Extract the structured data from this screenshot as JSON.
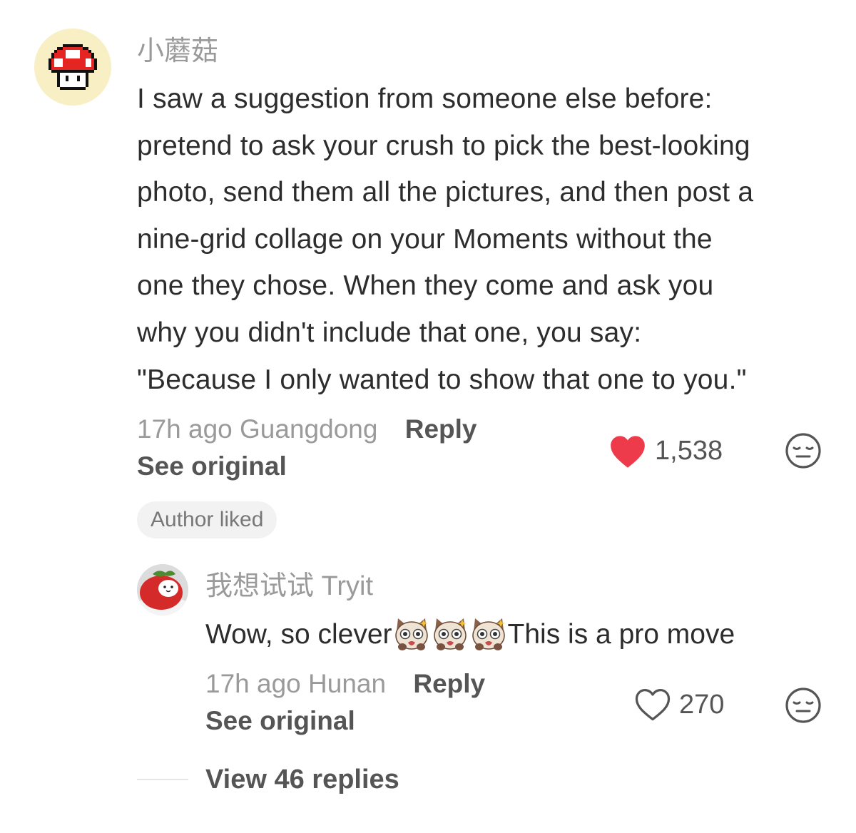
{
  "comment": {
    "username": "小蘑菇",
    "avatar_icon": "mushroom-icon",
    "lines": [
      "I saw a suggestion from someone else before:",
      "pretend to ask your crush to pick the best-looking",
      "photo, send them all the pictures, and then post a",
      "nine-grid collage on your Moments without the",
      "one they chose. When they come and ask you",
      "why you didn't include that one, you say:",
      "\"Because I only wanted to show that one to you.\""
    ],
    "time": "17h ago",
    "location": "Guangdong",
    "reply_label": "Reply",
    "see_original": "See original",
    "likes": "1,538",
    "liked": true,
    "author_liked": "Author liked",
    "heart_color": "#ee3b4b"
  },
  "reply": {
    "username": "我想试试 Tryit",
    "text_before": "Wow, so clever",
    "emojis": [
      "cat-shocked-emoji",
      "cat-shocked-emoji",
      "cat-shocked-emoji"
    ],
    "text_after": "This is a pro move",
    "time": "17h ago",
    "location": "Hunan",
    "reply_label": "Reply",
    "see_original": "See original",
    "likes": "270",
    "liked": false
  },
  "view_replies": "View 46 replies"
}
